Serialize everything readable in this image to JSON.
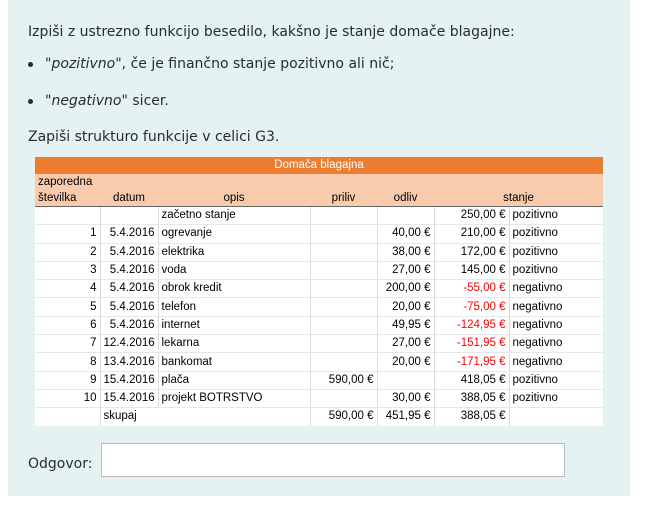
{
  "instruction": {
    "intro": "Izpiši z ustrezno funkcijo besedilo, kakšno je stanje domače blagajne:",
    "bullets": [
      {
        "term": "\"pozitivno\"",
        "rest": ", če je finančno stanje pozitivno ali nič;"
      },
      {
        "term": "\"negativno\"",
        "rest": " sicer."
      }
    ],
    "task": "Zapiši strukturo funkcije v celici G3."
  },
  "sheet": {
    "title": "Domača blagajna",
    "headers": {
      "seq_line1": "zaporedna",
      "seq_line2": "številka",
      "datum": "datum",
      "opis": "opis",
      "priliv": "priliv",
      "odliv": "odliv",
      "stanje": "stanje"
    },
    "rows": [
      {
        "seq": "",
        "datum": "",
        "opis": "začetno stanje",
        "priliv": "",
        "odliv": "",
        "stanje": "250,00 €",
        "status": "pozitivno",
        "neg": false
      },
      {
        "seq": "1",
        "datum": "5.4.2016",
        "opis": "ogrevanje",
        "priliv": "",
        "odliv": "40,00 €",
        "stanje": "210,00 €",
        "status": "pozitivno",
        "neg": false
      },
      {
        "seq": "2",
        "datum": "5.4.2016",
        "opis": "elektrika",
        "priliv": "",
        "odliv": "38,00 €",
        "stanje": "172,00 €",
        "status": "pozitivno",
        "neg": false
      },
      {
        "seq": "3",
        "datum": "5.4.2016",
        "opis": "voda",
        "priliv": "",
        "odliv": "27,00 €",
        "stanje": "145,00 €",
        "status": "pozitivno",
        "neg": false
      },
      {
        "seq": "4",
        "datum": "5.4.2016",
        "opis": "obrok kredit",
        "priliv": "",
        "odliv": "200,00 €",
        "stanje": "-55,00 €",
        "status": "negativno",
        "neg": true
      },
      {
        "seq": "5",
        "datum": "5.4.2016",
        "opis": "telefon",
        "priliv": "",
        "odliv": "20,00 €",
        "stanje": "-75,00 €",
        "status": "negativno",
        "neg": true
      },
      {
        "seq": "6",
        "datum": "5.4.2016",
        "opis": "internet",
        "priliv": "",
        "odliv": "49,95 €",
        "stanje": "-124,95 €",
        "status": "negativno",
        "neg": true
      },
      {
        "seq": "7",
        "datum": "12.4.2016",
        "opis": "lekarna",
        "priliv": "",
        "odliv": "27,00 €",
        "stanje": "-151,95 €",
        "status": "negativno",
        "neg": true
      },
      {
        "seq": "8",
        "datum": "13.4.2016",
        "opis": "bankomat",
        "priliv": "",
        "odliv": "20,00 €",
        "stanje": "-171,95 €",
        "status": "negativno",
        "neg": true
      },
      {
        "seq": "9",
        "datum": "15.4.2016",
        "opis": "plača",
        "priliv": "590,00 €",
        "odliv": "",
        "stanje": "418,05 €",
        "status": "pozitivno",
        "neg": false
      },
      {
        "seq": "10",
        "datum": "15.4.2016",
        "opis": "projekt BOTRSTVO",
        "priliv": "",
        "odliv": "30,00 €",
        "stanje": "388,05 €",
        "status": "pozitivno",
        "neg": false
      }
    ],
    "total": {
      "label": "skupaj",
      "priliv": "590,00 €",
      "odliv": "451,95 €",
      "stanje": "388,05 €"
    },
    "colors": {
      "title_bg": "#ed7d31",
      "header_bg": "#f8cbad",
      "negative": "#ff0000"
    }
  },
  "answer": {
    "label": "Odgovor:",
    "value": ""
  }
}
